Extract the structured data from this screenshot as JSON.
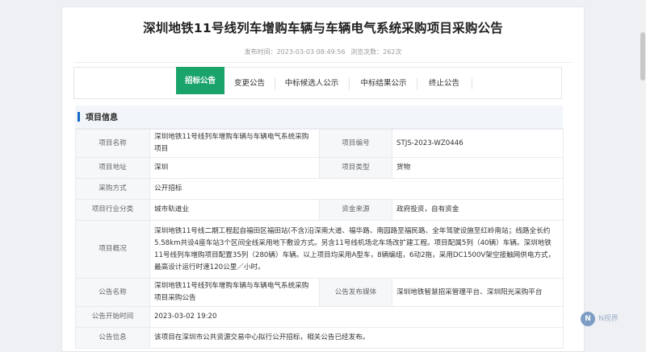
{
  "page": {
    "title": "深圳地铁11号线列车增购车辆与车辆电气系统采购项目采购公告",
    "publish_time": "发布时间：2023-03-03 08:49:56",
    "view_count": "浏览次数：262次"
  },
  "tabs": [
    {
      "label": "招标公告",
      "active": true
    },
    {
      "label": "变更公告",
      "active": false
    },
    {
      "label": "中标候选人公示",
      "active": false
    },
    {
      "label": "中标结果公示",
      "active": false
    },
    {
      "label": "终止公告",
      "active": false
    }
  ],
  "section": {
    "title": "项目信息",
    "accent": "#1769c7"
  },
  "info": {
    "project_name_label": "项目名称",
    "project_name": "深圳地铁11号线列车增购车辆与车辆电气系统采购项目",
    "project_no_label": "项目编号",
    "project_no": "STJS-2023-WZ0446",
    "location_label": "项目地址",
    "location": "深圳",
    "type_label": "项目类型",
    "type": "货物",
    "method_label": "采购方式",
    "method": "公开招标",
    "industry_label": "项目行业分类",
    "industry": "城市轨道业",
    "fund_label": "资金来源",
    "fund": "政府投资，自有资金",
    "overview_label": "项目概况",
    "overview": "深圳地铁11号线二期工程起自福田区福田站(不含)沿深南大道、福华路、南园路至福民路、全年驾驶设施至红岭南站；线路全长约5.58km共设4座车站3个区间全线采用地下敷设方式。另含11号线机场北车场改扩建工程。项目配属5列（40辆）车辆。深圳地铁11号线列车增购项目配置35列（280辆）车辆。以上项目均采用A型车，8辆编组，6动2拖，采用DC1500V架空接触网供电方式，最高设计运行时速120公里／小时。",
    "notice_name_label": "公告名称",
    "notice_name": "深圳地铁11号线列车增购车辆与车辆电气系统采购项目采购公告",
    "platform_label": "公告发布媒体",
    "platform": "深圳地铁智慧招采管理平台、深圳阳光采购平台",
    "start_time_label": "公告开始时间",
    "start_time": "2023-03-02 19:20",
    "notice_info_label": "公告信息",
    "notice_info": "该项目在深圳市公共资源交易中心拟行公开招标，相关公告已经发布。"
  },
  "watermark": {
    "text": "N视界"
  },
  "colors": {
    "active_tab": "#1aa36b",
    "label_bg": "#f6f7f9"
  }
}
